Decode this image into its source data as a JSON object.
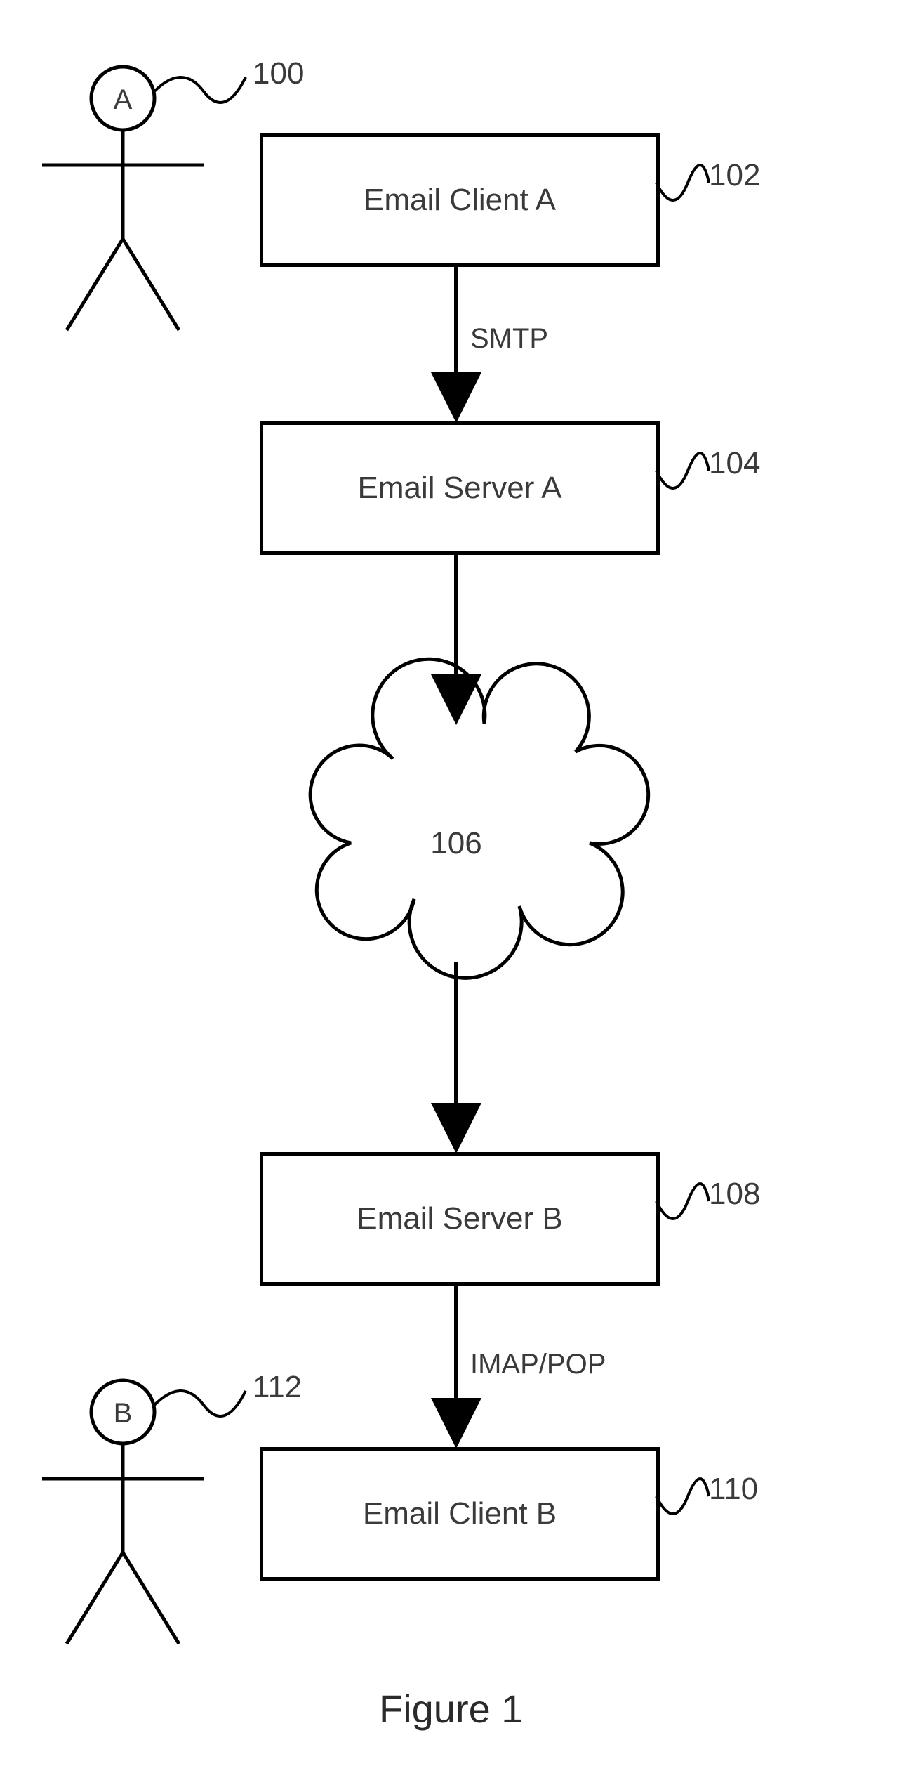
{
  "nodes": {
    "user_a": {
      "label": "A",
      "ref": "100"
    },
    "client_a": {
      "label": "Email Client A",
      "ref": "102"
    },
    "server_a": {
      "label": "Email Server A",
      "ref": "104"
    },
    "cloud": {
      "label": "106"
    },
    "server_b": {
      "label": "Email Server B",
      "ref": "108"
    },
    "client_b": {
      "label": "Email Client B",
      "ref": "110"
    },
    "user_b": {
      "label": "B",
      "ref": "112"
    }
  },
  "edges": {
    "smtp": "SMTP",
    "imap": "IMAP/POP"
  },
  "caption": "Figure 1"
}
